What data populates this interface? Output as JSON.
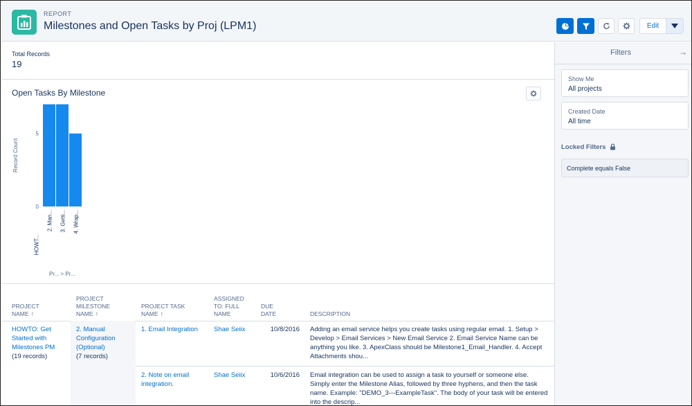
{
  "header": {
    "eyebrow": "REPORT",
    "title": "Milestones and Open Tasks by Proj (LPM1)",
    "edit_label": "Edit",
    "icons": [
      "chart-icon",
      "filter-icon",
      "refresh-icon",
      "gear-icon",
      "chevron-down-icon"
    ]
  },
  "summary": {
    "label": "Total Records",
    "value": "19"
  },
  "chart_data": {
    "type": "bar",
    "title": "Open Tasks By Milestone",
    "ylabel": "Record Count",
    "xlabel": "Pr... > Pr...",
    "y_ticks": [
      "5",
      "0"
    ],
    "ylim": [
      0,
      7.5
    ],
    "categories": [
      "2. Man...",
      "3. Getti...",
      "4. Wrap..."
    ],
    "group_label": "HOWT...",
    "values": [
      7,
      7,
      5
    ],
    "bar_color": "#1589ee"
  },
  "filters": {
    "title": "Filters",
    "cards": [
      {
        "label": "Show Me",
        "value": "All projects"
      },
      {
        "label": "Created Date",
        "value": "All time"
      }
    ],
    "locked_title": "Locked Filters",
    "locked_items": [
      "Complete equals False"
    ]
  },
  "table": {
    "headers": [
      {
        "lines": [
          "PROJECT",
          "NAME"
        ],
        "sort": "↑"
      },
      {
        "lines": [
          "PROJECT",
          "MILESTONE",
          "NAME"
        ],
        "sort": "↑"
      },
      {
        "lines": [
          "PROJECT TASK",
          "NAME"
        ],
        "sort": "↑"
      },
      {
        "lines": [
          "ASSIGNED",
          "TO: FULL",
          "NAME"
        ],
        "sort": ""
      },
      {
        "lines": [
          "DUE",
          "DATE"
        ],
        "sort": ""
      },
      {
        "lines": [
          "DESCRIPTION"
        ],
        "sort": ""
      }
    ],
    "group1": {
      "name": "HOWTO: Get Started with Milestones PM",
      "count": "(19 records)"
    },
    "group2": {
      "name": "2. Manual Configuration (Optional)",
      "count": "(7 records)"
    },
    "rows": [
      {
        "task": "1. Email Integration",
        "assigned": "Shae Seiix",
        "due": "10/8/2016",
        "description": "Adding an email service helps you create tasks using regular email.  1. Setup > Develop > Email Services > New Email Service 2. Email Service Name can be anything you like.  3. ApexClass should be Milestone1_Email_Handler. 4. Accept Attachments shou..."
      },
      {
        "task": "2. Note on email integration.",
        "assigned": "Shae Seiix",
        "due": "10/6/2016",
        "description": "Email integration can be used to assign a task to yourself or someone else.  Simply enter the Milestone Alias, followed by three hyphens, and then the task name.  Example: \"DEMO_3---ExampleTask\".  The body of your task will be entered into the descrip..."
      }
    ]
  }
}
